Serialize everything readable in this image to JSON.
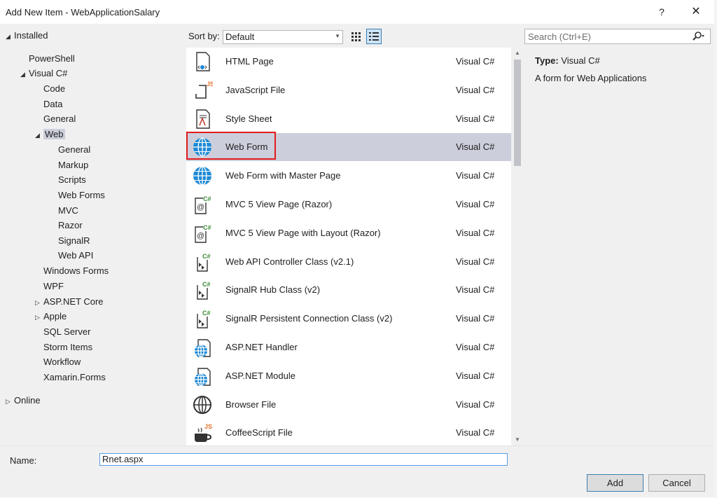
{
  "window": {
    "title": "Add New Item - WebApplicationSalary",
    "help": "?",
    "close": "✕"
  },
  "tree": [
    {
      "label": "Installed",
      "glyph": "◢",
      "indent": 0
    },
    {
      "label": "PowerShell",
      "glyph": "",
      "indent": 1
    },
    {
      "label": "Visual C#",
      "glyph": "◢",
      "indent": 1
    },
    {
      "label": "Code",
      "glyph": "",
      "indent": 2
    },
    {
      "label": "Data",
      "glyph": "",
      "indent": 2
    },
    {
      "label": "General",
      "glyph": "",
      "indent": 2
    },
    {
      "label": "Web",
      "glyph": "◢",
      "indent": 2,
      "selected": true
    },
    {
      "label": "General",
      "glyph": "",
      "indent": 3
    },
    {
      "label": "Markup",
      "glyph": "",
      "indent": 3
    },
    {
      "label": "Scripts",
      "glyph": "",
      "indent": 3
    },
    {
      "label": "Web Forms",
      "glyph": "",
      "indent": 3
    },
    {
      "label": "MVC",
      "glyph": "",
      "indent": 3
    },
    {
      "label": "Razor",
      "glyph": "",
      "indent": 3
    },
    {
      "label": "SignalR",
      "glyph": "",
      "indent": 3
    },
    {
      "label": "Web API",
      "glyph": "",
      "indent": 3
    },
    {
      "label": "Windows Forms",
      "glyph": "",
      "indent": 2
    },
    {
      "label": "WPF",
      "glyph": "",
      "indent": 2
    },
    {
      "label": "ASP.NET Core",
      "glyph": "▷",
      "indent": 2
    },
    {
      "label": "Apple",
      "glyph": "▷",
      "indent": 2
    },
    {
      "label": "SQL Server",
      "glyph": "",
      "indent": 2
    },
    {
      "label": "Storm Items",
      "glyph": "",
      "indent": 2
    },
    {
      "label": "Workflow",
      "glyph": "",
      "indent": 2
    },
    {
      "label": "Xamarin.Forms",
      "glyph": "",
      "indent": 2
    },
    {
      "label": "Online",
      "glyph": "▷",
      "indent": 0
    }
  ],
  "toolbar": {
    "sort_label": "Sort by:",
    "sort_value": "Default",
    "search_placeholder": "Search (Ctrl+E)"
  },
  "items": [
    {
      "name": "HTML Page",
      "lang": "Visual C#",
      "icon": "html-page-icon"
    },
    {
      "name": "JavaScript File",
      "lang": "Visual C#",
      "icon": "javascript-file-icon"
    },
    {
      "name": "Style Sheet",
      "lang": "Visual C#",
      "icon": "style-sheet-icon"
    },
    {
      "name": "Web Form",
      "lang": "Visual C#",
      "icon": "web-form-icon",
      "selected": true
    },
    {
      "name": "Web Form with Master Page",
      "lang": "Visual C#",
      "icon": "web-form-master-icon"
    },
    {
      "name": "MVC 5 View Page (Razor)",
      "lang": "Visual C#",
      "icon": "razor-view-icon"
    },
    {
      "name": "MVC 5 View Page with Layout (Razor)",
      "lang": "Visual C#",
      "icon": "razor-view-icon"
    },
    {
      "name": "Web API Controller Class (v2.1)",
      "lang": "Visual C#",
      "icon": "csharp-class-icon"
    },
    {
      "name": "SignalR Hub Class (v2)",
      "lang": "Visual C#",
      "icon": "csharp-class-icon"
    },
    {
      "name": "SignalR Persistent Connection Class (v2)",
      "lang": "Visual C#",
      "icon": "csharp-class-icon"
    },
    {
      "name": "ASP.NET Handler",
      "lang": "Visual C#",
      "icon": "globe-file-icon"
    },
    {
      "name": "ASP.NET Module",
      "lang": "Visual C#",
      "icon": "globe-file-icon"
    },
    {
      "name": "Browser File",
      "lang": "Visual C#",
      "icon": "browser-file-icon"
    },
    {
      "name": "CoffeeScript File",
      "lang": "Visual C#",
      "icon": "coffeescript-file-icon"
    }
  ],
  "details": {
    "type_label": "Type:",
    "type_value": "Visual C#",
    "description": "A form for Web Applications"
  },
  "bottom": {
    "name_label": "Name:",
    "name_value": "Rnet.aspx",
    "add_label": "Add",
    "cancel_label": "Cancel"
  },
  "colors": {
    "selection": "#cccedb",
    "highlight": "#e21b1b",
    "globe_blue": "#1e8ad6"
  }
}
